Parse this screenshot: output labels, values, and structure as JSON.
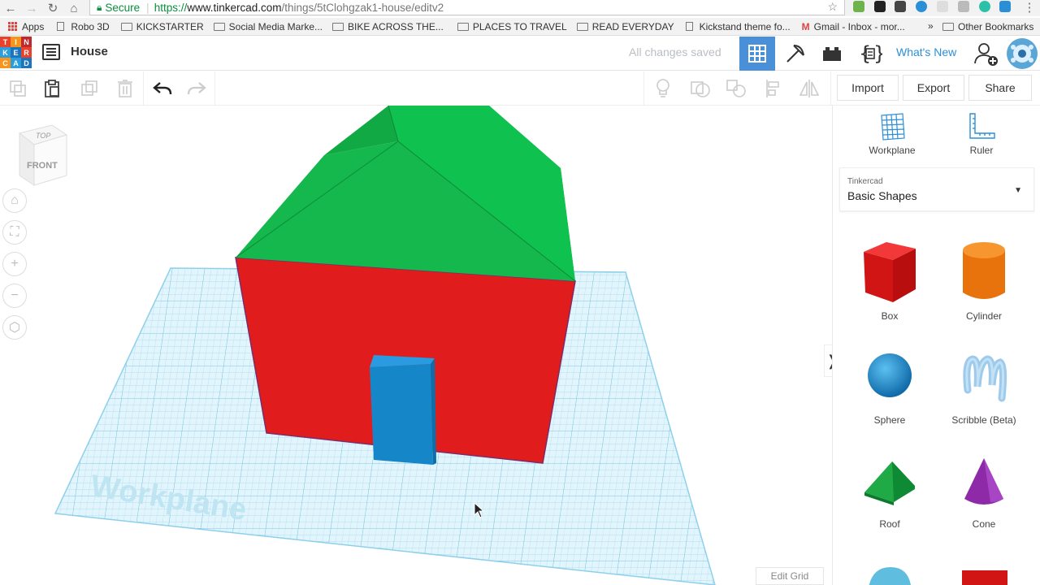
{
  "browser": {
    "secure_label": "Secure",
    "url_https": "https://",
    "url_host": "www.tinkercad.com",
    "url_path": "/things/5tClohgzak1-house/editv2",
    "bookmarks": [
      {
        "label": "Apps",
        "icon": "apps-grid-icon"
      },
      {
        "label": "Robo 3D",
        "icon": "page-icon"
      },
      {
        "label": "KICKSTARTER",
        "icon": "folder-icon"
      },
      {
        "label": "Social Media Marke...",
        "icon": "folder-icon"
      },
      {
        "label": "BIKE ACROSS THE...",
        "icon": "folder-icon"
      },
      {
        "label": "PLACES TO TRAVEL",
        "icon": "folder-icon"
      },
      {
        "label": "READ EVERYDAY",
        "icon": "folder-icon"
      },
      {
        "label": "Kickstand theme fo...",
        "icon": "page-icon"
      },
      {
        "label": "Gmail - Inbox - mor...",
        "icon": "gmail-icon"
      }
    ],
    "other_bookmarks": "Other Bookmarks",
    "overflow": "»"
  },
  "app": {
    "logo_letters": [
      "T",
      "I",
      "N",
      "K",
      "E",
      "R",
      "C",
      "A",
      "D"
    ],
    "logo_colors": [
      "#e8412c",
      "#f7941d",
      "#c1272d",
      "#2e9edb",
      "#1c75bc",
      "#e8412c",
      "#f7941d",
      "#2e9edb",
      "#1c75bc"
    ],
    "project_title": "House",
    "save_status": "All changes saved",
    "whats_new": "What's New"
  },
  "toolbar": {
    "import_label": "Import",
    "export_label": "Export",
    "share_label": "Share"
  },
  "viewport": {
    "viewcube_top": "TOP",
    "viewcube_front": "FRONT",
    "workplane_label": "Workplane",
    "edit_grid_label": "Edit Grid"
  },
  "panel": {
    "workplane_label": "Workplane",
    "ruler_label": "Ruler",
    "library_caption": "Tinkercad",
    "library_value": "Basic Shapes",
    "shapes": [
      {
        "label": "Box",
        "color": "#e11c1c"
      },
      {
        "label": "Cylinder",
        "color": "#f07a10"
      },
      {
        "label": "Sphere",
        "color": "#1a8fd6"
      },
      {
        "label": "Scribble (Beta)",
        "color": "#8fc1e6"
      },
      {
        "label": "Roof",
        "color": "#1ea84a"
      },
      {
        "label": "Cone",
        "color": "#8e2aa8"
      }
    ]
  },
  "colors": {
    "accent": "#2b8fd7",
    "active_tool": "#4a90d9",
    "wall": "#e11c1c",
    "roof": "#10b84a",
    "door": "#1587c9",
    "workplane": "#bfe9f6"
  }
}
